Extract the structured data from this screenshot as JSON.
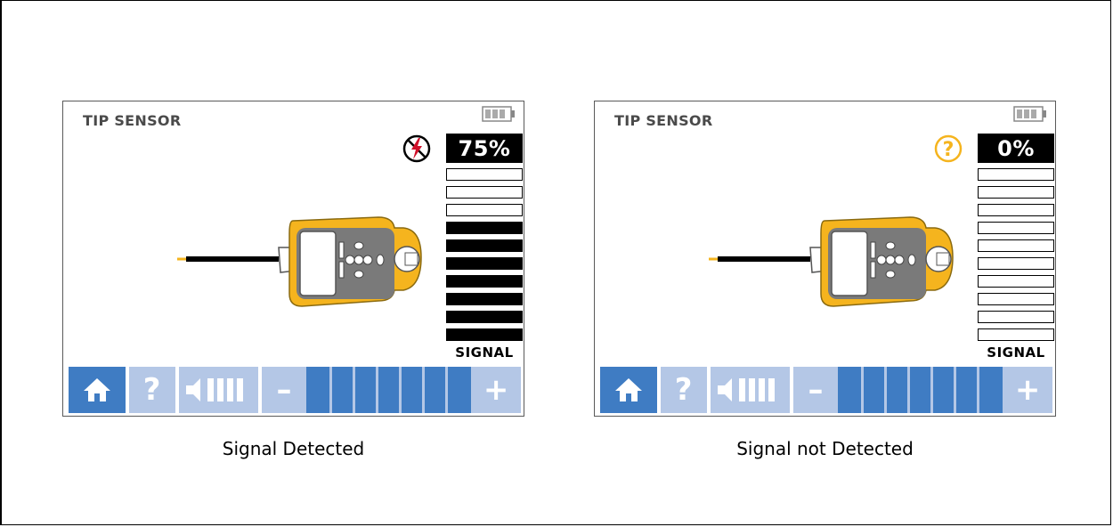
{
  "panels": [
    {
      "title": "TIP SENSOR",
      "percent": "75%",
      "status_icon": "no-voltage-icon",
      "signal_label": "SIGNAL",
      "bars_total": 10,
      "bars_on": 7,
      "caption": "Signal Detected"
    },
    {
      "title": "TIP SENSOR",
      "percent": "0%",
      "status_icon": "question-circle-icon",
      "signal_label": "SIGNAL",
      "bars_total": 10,
      "bars_on": 0,
      "caption": "Signal not Detected"
    }
  ],
  "toolbar": {
    "help_label": "?",
    "minus_label": "–",
    "plus_label": "+",
    "volume_level": 4,
    "level_segments": 7
  },
  "colors": {
    "accent_blue": "#3f7cc3",
    "light_blue": "#b4c7e6",
    "device_yellow": "#f5b41e",
    "device_gray": "#7a7a7a",
    "question_yellow": "#f5b41e",
    "warning_red": "#d0102a"
  }
}
